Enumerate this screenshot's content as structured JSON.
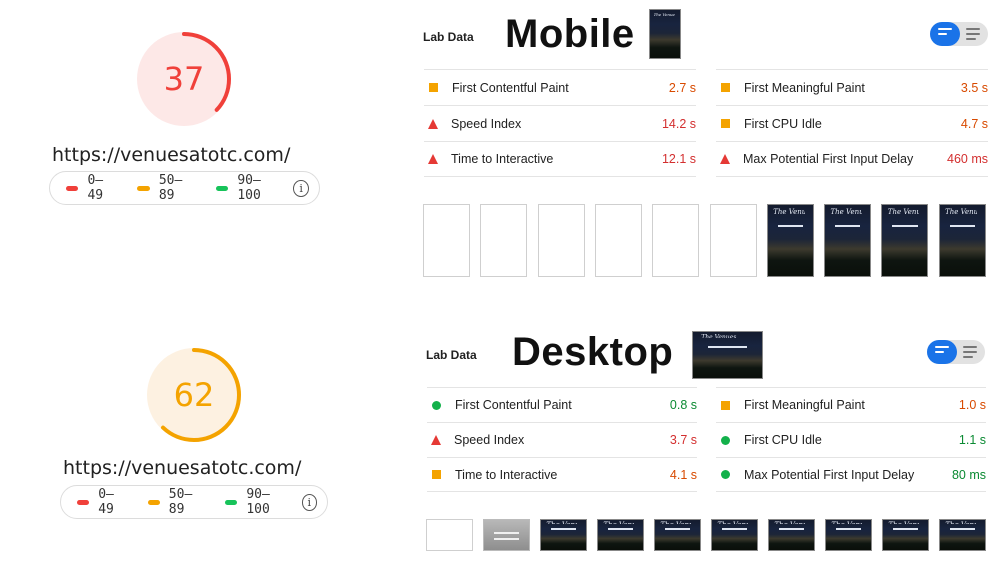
{
  "legend": {
    "low": "0–49",
    "mid": "50–89",
    "high": "90–100",
    "colors": {
      "low": "#f0403a",
      "mid": "#f4a300",
      "high": "#17c35a"
    },
    "info_icon": "info-icon"
  },
  "mobile": {
    "score": "37",
    "score_fraction": 0.37,
    "score_color": "#f0403a",
    "score_bg": "#fde8e7",
    "url": "https://venuesatotc.com/",
    "lab_label": "Lab Data",
    "title": "Mobile",
    "metrics_left": [
      {
        "name": "First Contentful Paint",
        "value": "2.7 s",
        "icon": "square",
        "tone": "orange"
      },
      {
        "name": "Speed Index",
        "value": "14.2 s",
        "icon": "triangle",
        "tone": "red"
      },
      {
        "name": "Time to Interactive",
        "value": "12.1 s",
        "icon": "triangle",
        "tone": "red"
      }
    ],
    "metrics_right": [
      {
        "name": "First Meaningful Paint",
        "value": "3.5 s",
        "icon": "square",
        "tone": "orange"
      },
      {
        "name": "First CPU Idle",
        "value": "4.7 s",
        "icon": "square",
        "tone": "orange"
      },
      {
        "name": "Max Potential First Input Delay",
        "value": "460 ms",
        "icon": "triangle",
        "tone": "red"
      }
    ],
    "filmstrip": [
      "blank",
      "blank",
      "blank",
      "blank",
      "blank",
      "blank",
      "shot",
      "shot",
      "shot",
      "shot"
    ],
    "thumb_logo": "The Venues"
  },
  "desktop": {
    "score": "62",
    "score_fraction": 0.62,
    "score_color": "#f4a300",
    "score_bg": "#fdf1e1",
    "url": "https://venuesatotc.com/",
    "lab_label": "Lab Data",
    "title": "Desktop",
    "metrics_left": [
      {
        "name": "First Contentful Paint",
        "value": "0.8 s",
        "icon": "circle",
        "tone": "green"
      },
      {
        "name": "Speed Index",
        "value": "3.7 s",
        "icon": "triangle",
        "tone": "red"
      },
      {
        "name": "Time to Interactive",
        "value": "4.1 s",
        "icon": "square",
        "tone": "orange"
      }
    ],
    "metrics_right": [
      {
        "name": "First Meaningful Paint",
        "value": "1.0 s",
        "icon": "square",
        "tone": "orange"
      },
      {
        "name": "First CPU Idle",
        "value": "1.1 s",
        "icon": "circle",
        "tone": "green"
      },
      {
        "name": "Max Potential First Input Delay",
        "value": "80 ms",
        "icon": "circle",
        "tone": "green"
      }
    ],
    "filmstrip": [
      "blank",
      "gray",
      "shot",
      "shot",
      "shot",
      "shot",
      "shot",
      "shot",
      "shot",
      "shot"
    ],
    "thumb_logo": "The Venues"
  }
}
